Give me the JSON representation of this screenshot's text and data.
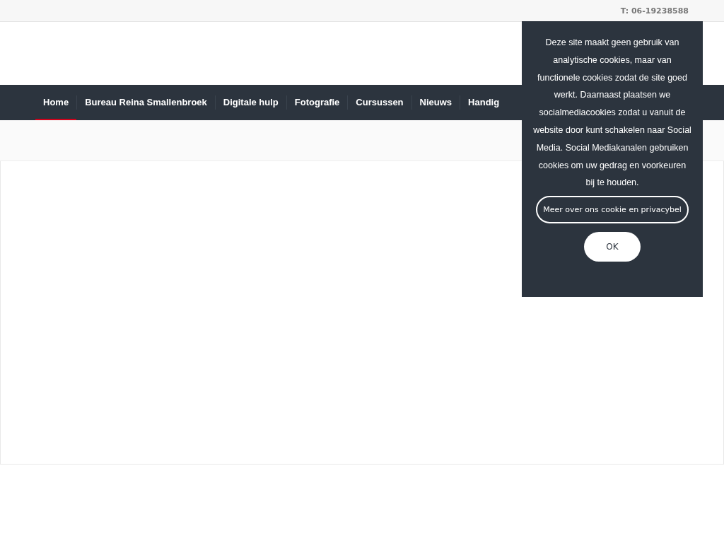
{
  "top_bar": {
    "phone": "T: 06-19238588"
  },
  "nav": {
    "items": [
      {
        "label": "Home",
        "selected": true
      },
      {
        "label": "Bureau Reina Smallenbroek",
        "selected": false
      },
      {
        "label": "Digitale hulp",
        "selected": false
      },
      {
        "label": "Fotografie",
        "selected": false
      },
      {
        "label": "Cursussen",
        "selected": false
      },
      {
        "label": "Nieuws",
        "selected": false
      },
      {
        "label": "Handig",
        "selected": false
      }
    ]
  },
  "cookie_notice": {
    "text": "Deze site maakt geen gebruik van analytische cookies, maar van functionele cookies zodat de site goed werkt. Daarnaast plaatsen we socialmediacookies zodat u vanuit de website door kunt schakelen naar Social Media. Social Mediakanalen gebruiken cookies om uw gedrag en voorkeuren bij te houden.",
    "policy_link": "Meer over ons cookie en privacybel",
    "ok_button": "OK"
  }
}
